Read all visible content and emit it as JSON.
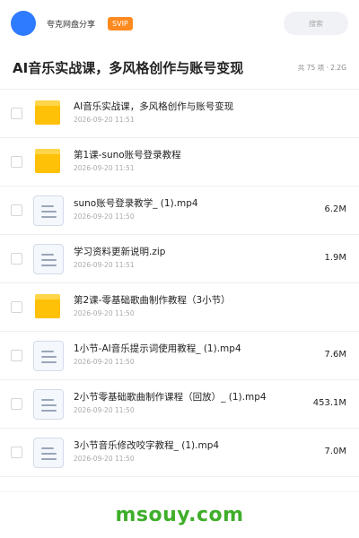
{
  "header": {
    "share_title": "夸克网盘分享",
    "badge": "SVIP",
    "search_placeholder": "搜索",
    "colors": {
      "avatar": "#2f7bff",
      "badge": "#ff8a1f"
    }
  },
  "folder": {
    "title": "AI音乐实战课，多风格创作与账号变现",
    "meta": "共 75 项 · 2.2G"
  },
  "files": [
    {
      "type": "folder",
      "icon": "folder-icon",
      "name": "AI音乐实战课，多风格创作与账号变现",
      "date": "2026-09-20 11:51",
      "size": ""
    },
    {
      "type": "folder",
      "icon": "folder-icon",
      "name": "第1课-suno账号登录教程",
      "date": "2026-09-20 11:51",
      "size": ""
    },
    {
      "type": "file",
      "icon": "document-icon",
      "name": "suno账号登录教学_ (1).mp4",
      "date": "2026-09-20 11:50",
      "size": "6.2M"
    },
    {
      "type": "file",
      "icon": "document-icon",
      "name": "学习资料更新说明.zip",
      "date": "2026-09-20 11:51",
      "size": "1.9M"
    },
    {
      "type": "folder",
      "icon": "folder-icon",
      "name": "第2课-零基础歌曲制作教程（3小节）",
      "date": "2026-09-20 11:50",
      "size": ""
    },
    {
      "type": "file",
      "icon": "document-icon",
      "name": "1小节-AI音乐提示词使用教程_ (1).mp4",
      "date": "2026-09-20 11:50",
      "size": "7.6M"
    },
    {
      "type": "file",
      "icon": "document-icon",
      "name": "2小节零基础歌曲制作课程（回放）_ (1).mp4",
      "date": "2026-09-20 11:50",
      "size": "453.1M"
    },
    {
      "type": "file",
      "icon": "document-icon",
      "name": "3小节音乐修改咬字教程_ (1).mp4",
      "date": "2026-09-20 11:50",
      "size": "7.0M"
    }
  ],
  "footer": {
    "watermark": "msouy.com",
    "color": "#3fae2a"
  }
}
